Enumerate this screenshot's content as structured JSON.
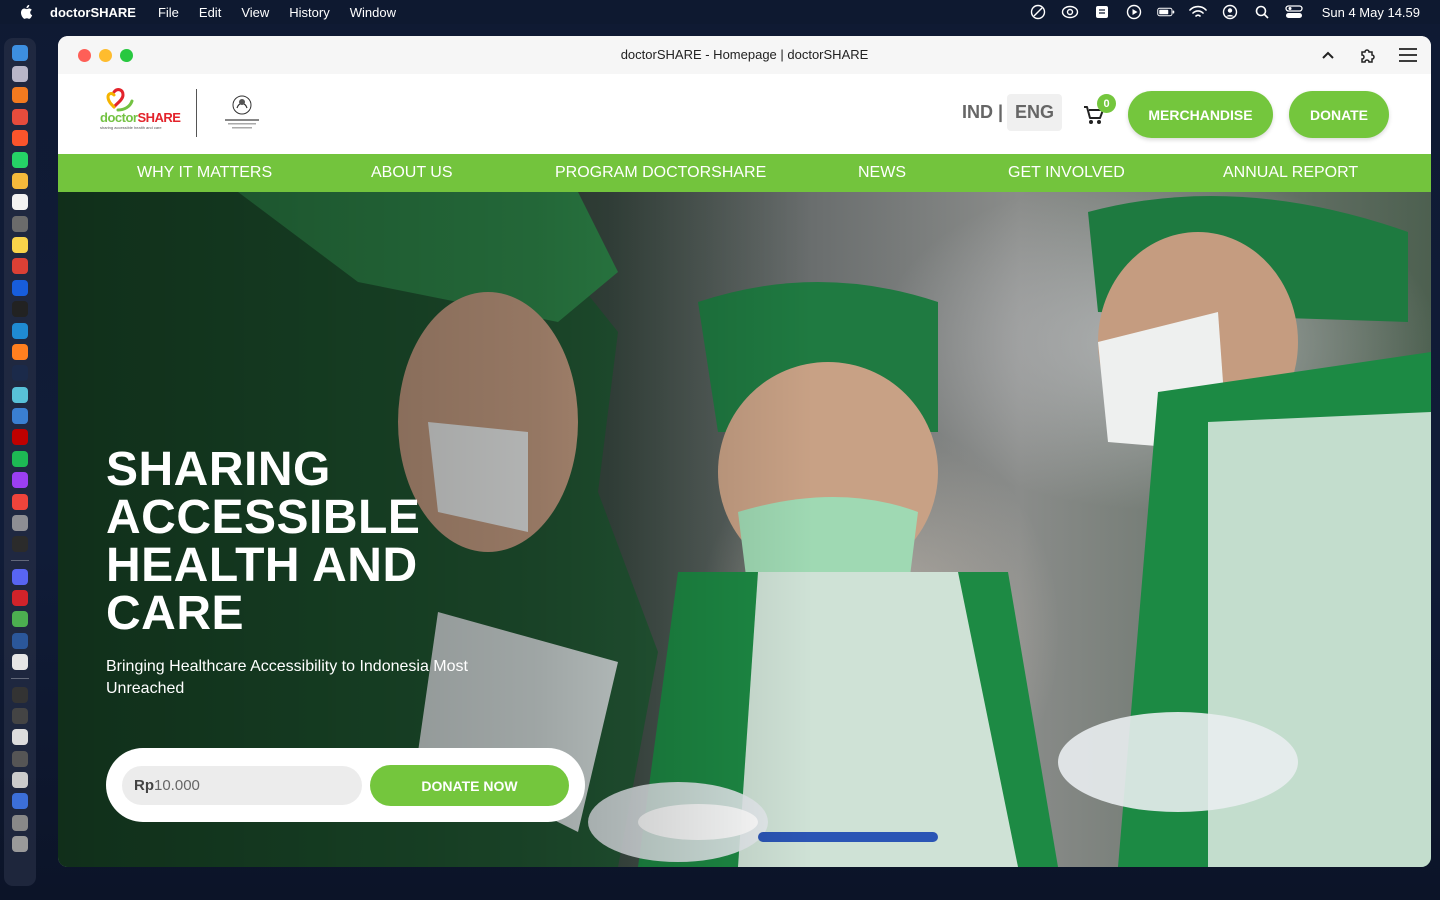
{
  "menubar": {
    "app_name": "doctorSHARE",
    "items": [
      "File",
      "Edit",
      "View",
      "History",
      "Window"
    ],
    "clock": "Sun 4 May  14.59"
  },
  "browser": {
    "tab_title": "doctorSHARE - Homepage | doctorSHARE"
  },
  "header": {
    "logo_word_doc": "doctor",
    "logo_word_share": "SHARE",
    "logo_tagline": "sharing accessible health and care",
    "lang_ind": "IND |",
    "lang_eng": "ENG",
    "cart_count": "0",
    "merch_label": "MERCHANDISE",
    "donate_label": "DONATE"
  },
  "nav": {
    "items": [
      "WHY IT MATTERS",
      "ABOUT US",
      "PROGRAM DOCTORSHARE",
      "NEWS",
      "GET INVOLVED",
      "ANNUAL REPORT"
    ]
  },
  "hero": {
    "title_lines": [
      "SHARING",
      "ACCESSIBLE",
      "HEALTH AND",
      "CARE"
    ],
    "subtitle": "Bringing Healthcare Accessibility to Indonesia Most Unreached",
    "currency": "Rp",
    "amount": "10.000",
    "donate_now_label": "DONATE NOW"
  },
  "colors": {
    "brand_green": "#74c63d",
    "brand_red": "#e3232b"
  }
}
